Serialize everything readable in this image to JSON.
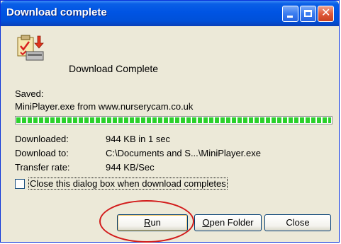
{
  "window": {
    "title": "Download complete",
    "controls": {
      "minimize": "minimize-icon",
      "maximize": "maximize-icon",
      "close": "close-icon"
    }
  },
  "header": {
    "text": "Download Complete",
    "icon": "download-complete-icon"
  },
  "saved": {
    "label": "Saved:",
    "filename": "MiniPlayer.exe from www.nurserycam.co.uk"
  },
  "progress": {
    "percent": 100,
    "color": "#2bd12b"
  },
  "details": [
    {
      "label": "Downloaded:",
      "value": "944 KB in 1 sec"
    },
    {
      "label": "Download to:",
      "value": "C:\\Documents and S...\\MiniPlayer.exe"
    },
    {
      "label": "Transfer rate:",
      "value": "944 KB/Sec"
    }
  ],
  "checkbox": {
    "label": "Close this dialog box when download completes",
    "checked": false
  },
  "buttons": {
    "run": "Run",
    "open_folder": "Open Folder",
    "close": "Close"
  },
  "annotation": {
    "color": "#d21a1a",
    "target": "run-button"
  }
}
